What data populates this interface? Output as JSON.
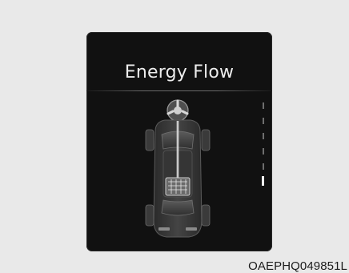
{
  "screen": {
    "title": "Energy Flow",
    "gauge_level": "6 of 6 markers shown; bottom marker highlighted",
    "vehicle_icon": "car-topview-icon"
  },
  "caption": {
    "text": "OAEPHQ049851L"
  },
  "colors": {
    "screen_bg": "#111111",
    "page_bg": "#e9e9e9",
    "title_text": "#ededed",
    "caption_text": "#1b1b1b"
  }
}
